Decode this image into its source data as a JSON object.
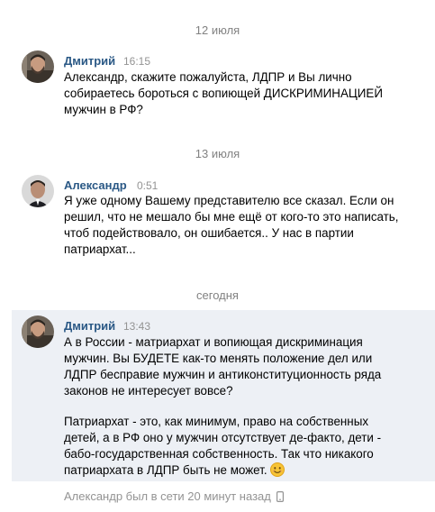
{
  "dates": {
    "first": "12 июля",
    "second": "13 июля",
    "third": "сегодня"
  },
  "messages": [
    {
      "author": "Дмитрий",
      "time": "16:15",
      "lines": [
        "Александр, скажите пожалуйста, ЛДПР и Вы лично",
        "собираетесь бороться с вопиющей ДИСКРИМИНАЦИЕЙ",
        "мужчин в РФ?"
      ]
    },
    {
      "author": "Александр",
      "time": "0:51",
      "lines": [
        "Я уже одному Вашему представителю все сказал. Если он",
        "решил, что не мешало бы мне ещё от кого-то это написать,",
        "чтоб подействовало, он ошибается.. У нас в партии",
        "патриархат..."
      ]
    },
    {
      "author": "Дмитрий",
      "time": "13:43",
      "lines": [
        "А в России - матриархат и вопиющая дискриминация",
        "мужчин. Вы БУДЕТЕ как-то менять положение дел или",
        "ЛДПР бесправие мужчин и антиконституционность ряда",
        "законов не интересует вовсе?"
      ],
      "lines2": [
        "Патриархат - это, как минимум, право на собственных",
        "детей, а в РФ оно у мужчин отсутствует де-факто, дети -",
        "бабо-государственная собственность. Так что никакого",
        "патриархата в ЛДПР быть не может."
      ]
    }
  ],
  "footer": {
    "status": "Александр был в сети 20 минут назад"
  },
  "colors": {
    "author_link": "#2a5885",
    "highlight_bg": "#edf0f5",
    "muted_text": "#939393"
  },
  "icons": {
    "emoji": "smiling-face-icon",
    "mobile": "mobile-phone-icon"
  }
}
